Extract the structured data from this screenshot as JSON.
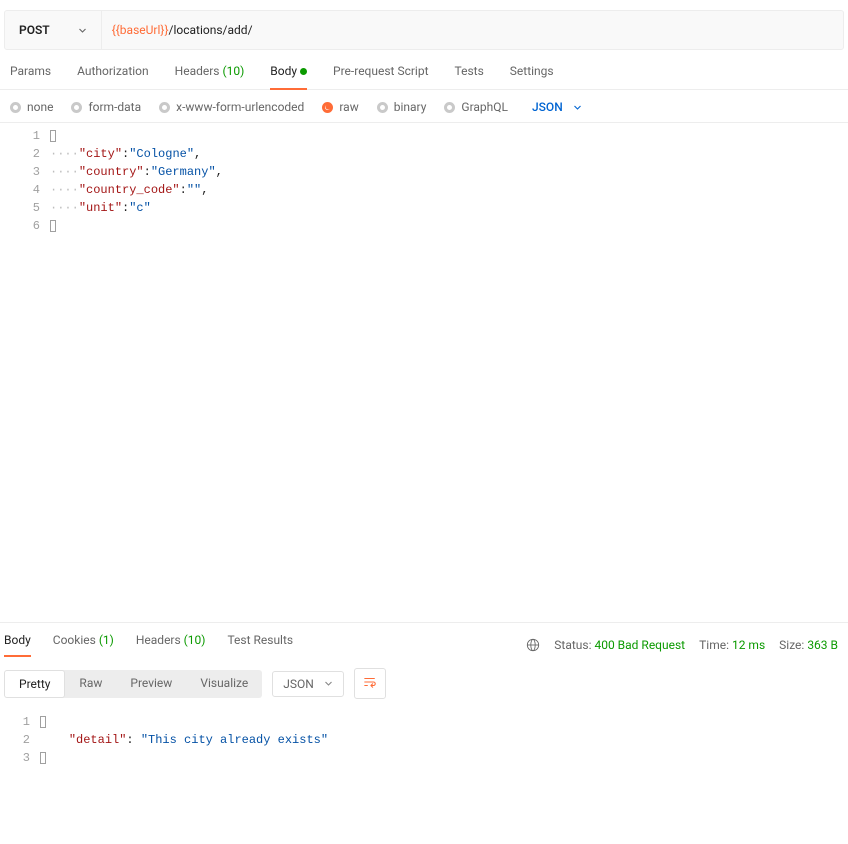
{
  "request": {
    "method": "POST",
    "url_var": "{{baseUrl}}",
    "url_path": "/locations/add/"
  },
  "tabs": {
    "params": "Params",
    "auth": "Authorization",
    "headers": "Headers",
    "headers_count": "(10)",
    "body": "Body",
    "prereq": "Pre-request Script",
    "tests": "Tests",
    "settings": "Settings"
  },
  "body_types": {
    "none": "none",
    "formdata": "form-data",
    "xwww": "x-www-form-urlencoded",
    "raw": "raw",
    "binary": "binary",
    "graphql": "GraphQL"
  },
  "format_selected": "JSON",
  "request_body": {
    "l1": "{",
    "l2": {
      "ind": "····",
      "k": "\"city\"",
      "c": ":",
      "v": "\"Cologne\"",
      "t": ","
    },
    "l3": {
      "ind": "····",
      "k": "\"country\"",
      "c": ":",
      "v": "\"Germany\"",
      "t": ","
    },
    "l4": {
      "ind": "····",
      "k": "\"country_code\"",
      "c": ":",
      "v": "\"\"",
      "t": ","
    },
    "l5": {
      "ind": "····",
      "k": "\"unit\"",
      "c": ":",
      "v": "\"c\"",
      "t": ""
    },
    "l6": "}"
  },
  "response_tabs": {
    "body": "Body",
    "cookies": "Cookies",
    "cookies_count": "(1)",
    "headers": "Headers",
    "headers_count": "(10)",
    "tests": "Test Results"
  },
  "response_meta": {
    "status_label": "Status:",
    "status_value": "400 Bad Request",
    "time_label": "Time:",
    "time_value": "12 ms",
    "size_label": "Size:",
    "size_value": "363 B"
  },
  "view_modes": {
    "pretty": "Pretty",
    "raw": "Raw",
    "preview": "Preview",
    "visualize": "Visualize"
  },
  "resp_format": "JSON",
  "response_body": {
    "l1": "{",
    "l2": {
      "ind": "    ",
      "k": "\"detail\"",
      "c": ": ",
      "v": "\"This city already exists\""
    },
    "l3": "}"
  }
}
